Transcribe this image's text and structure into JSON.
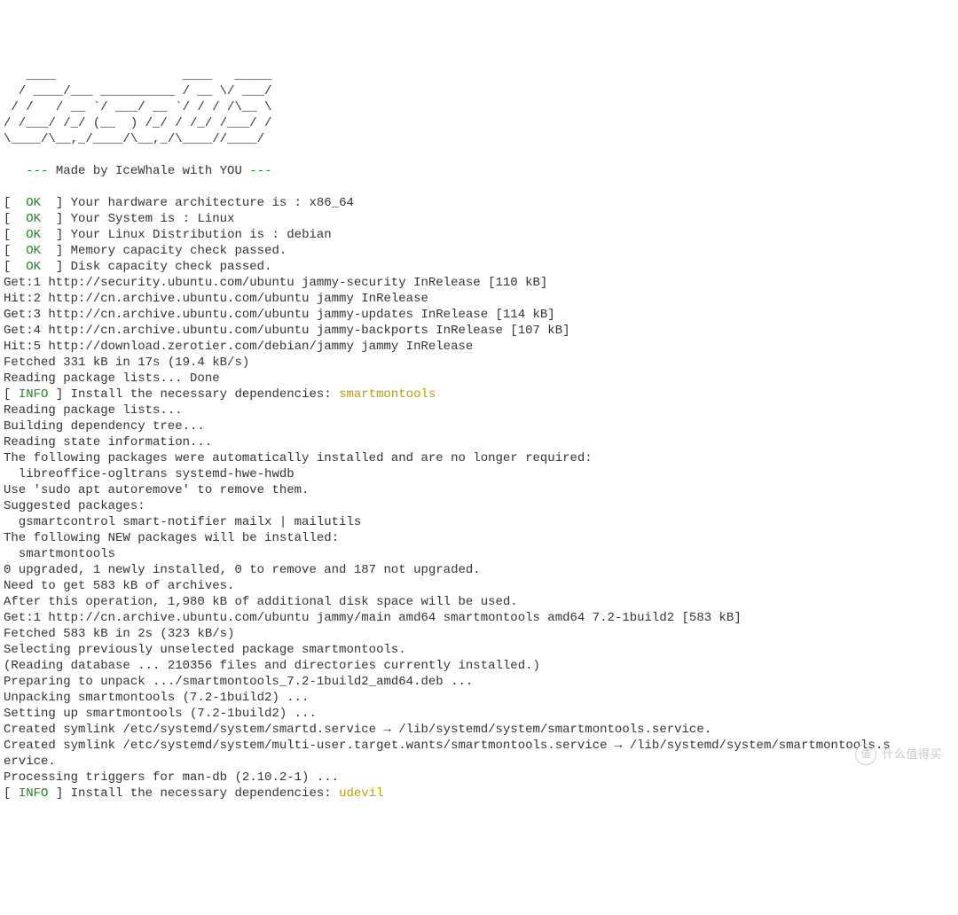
{
  "ascii_art": "   ____                 ____   _____\n  / ____/___ __________ / __ \\/ ___/\n / /   / __ `/ ___/ __ `/ / / /\\__ \\\n/ /___/ /_/ (__  ) /_/ / /_/ /___/ /\n\\____/\\__,_/____/\\__,_/\\____//____/",
  "tagline_prefix": "   --- ",
  "tagline": "Made by IceWhale with YOU",
  "tagline_suffix": " ---",
  "checks": [
    "Your hardware architecture is : x86_64",
    "Your System is : Linux",
    "Your Linux Distribution is : debian",
    "Memory capacity check passed.",
    "Disk capacity check passed."
  ],
  "ok_label": "OK",
  "info_label": "INFO",
  "apt1": [
    "Get:1 http://security.ubuntu.com/ubuntu jammy-security InRelease [110 kB]",
    "Hit:2 http://cn.archive.ubuntu.com/ubuntu jammy InRelease",
    "Get:3 http://cn.archive.ubuntu.com/ubuntu jammy-updates InRelease [114 kB]",
    "Get:4 http://cn.archive.ubuntu.com/ubuntu jammy-backports InRelease [107 kB]",
    "Hit:5 http://download.zerotier.com/debian/jammy jammy InRelease",
    "Fetched 331 kB in 17s (19.4 kB/s)",
    "Reading package lists... Done"
  ],
  "install1_msg": "Install the necessary dependencies: ",
  "install1_pkg": "smartmontools",
  "apt2": [
    "Reading package lists...",
    "Building dependency tree...",
    "Reading state information...",
    "The following packages were automatically installed and are no longer required:",
    "  libreoffice-ogltrans systemd-hwe-hwdb",
    "Use 'sudo apt autoremove' to remove them.",
    "Suggested packages:",
    "  gsmartcontrol smart-notifier mailx | mailutils",
    "The following NEW packages will be installed:",
    "  smartmontools",
    "0 upgraded, 1 newly installed, 0 to remove and 187 not upgraded.",
    "Need to get 583 kB of archives.",
    "After this operation, 1,980 kB of additional disk space will be used.",
    "Get:1 http://cn.archive.ubuntu.com/ubuntu jammy/main amd64 smartmontools amd64 7.2-1build2 [583 kB]",
    "Fetched 583 kB in 2s (323 kB/s)",
    "Selecting previously unselected package smartmontools.",
    "(Reading database ... 210356 files and directories currently installed.)",
    "Preparing to unpack .../smartmontools_7.2-1build2_amd64.deb ...",
    "Unpacking smartmontools (7.2-1build2) ...",
    "Setting up smartmontools (7.2-1build2) ...",
    "Created symlink /etc/systemd/system/smartd.service → /lib/systemd/system/smartmontools.service.",
    "Created symlink /etc/systemd/system/multi-user.target.wants/smartmontools.service → /lib/systemd/system/smartmontools.s",
    "ervice.",
    "Processing triggers for man-db (2.10.2-1) ..."
  ],
  "install2_msg": "Install the necessary dependencies: ",
  "install2_pkg": "udevil",
  "watermark_text": "什么值得买",
  "watermark_badge": "值"
}
